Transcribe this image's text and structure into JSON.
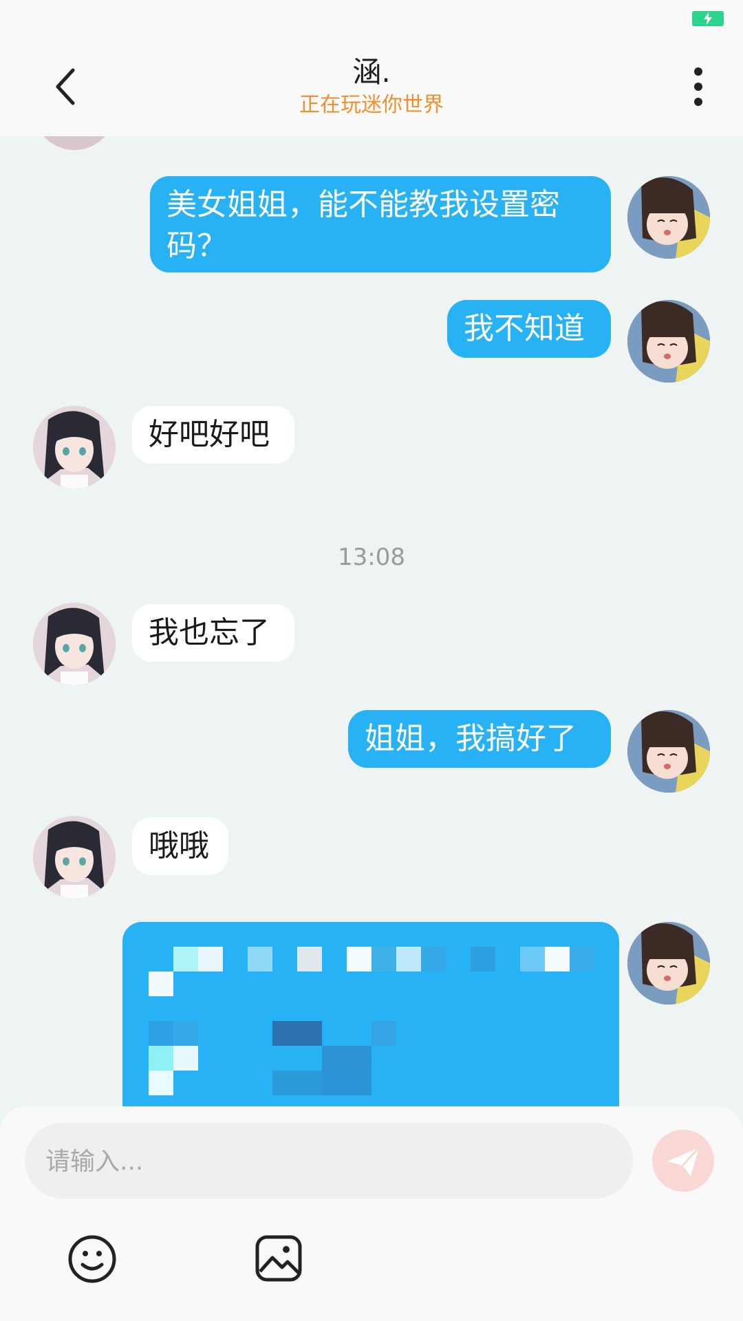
{
  "header": {
    "title": "涵.",
    "subtitle": "正在玩迷你世界"
  },
  "messages": [
    {
      "side": "me",
      "text": "美女姐姐，能不能教我设置密码？"
    },
    {
      "side": "me",
      "text": "我不知道"
    },
    {
      "side": "her",
      "text": "好吧好吧"
    },
    {
      "side": "her",
      "text": "我也忘了"
    },
    {
      "side": "me",
      "text": "姐姐，我搞好了"
    },
    {
      "side": "her",
      "text": "哦哦"
    }
  ],
  "timestamp": "13:08",
  "input": {
    "placeholder": "请输入..."
  },
  "icons": {
    "back": "chevron-left-icon",
    "more": "more-vertical-icon",
    "send": "paper-plane-icon",
    "emoji": "smiley-icon",
    "image": "image-icon",
    "battery": "battery-charging-icon"
  },
  "colors": {
    "my_bubble": "#26b2f4",
    "her_bubble": "#ffffff",
    "subtitle": "#f0912d",
    "background": "#eef4f3",
    "battery": "#2bd38d"
  }
}
